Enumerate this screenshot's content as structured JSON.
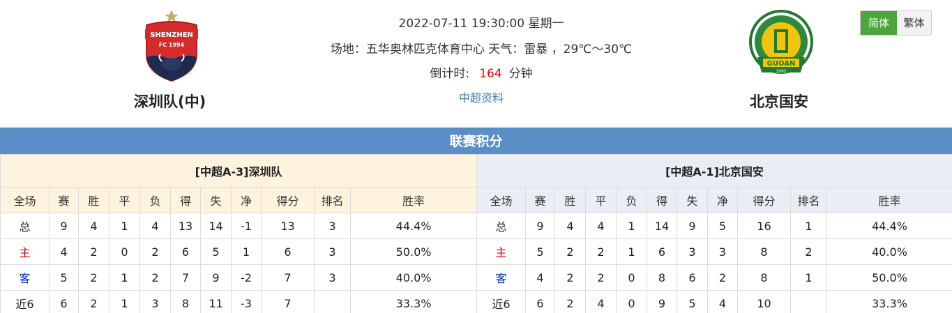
{
  "match": {
    "datetime": "2022-07-11 19:30:00 星期一",
    "venue": "场地：五华奥林匹克体育中心 天气：雷暴 ，29℃～30℃",
    "countdown_label": "倒计时:",
    "countdown_value": "164",
    "countdown_unit": "分钟",
    "league_link": "中超资料"
  },
  "home_team": {
    "name": "深圳队(中)",
    "logo_text": "SHENZHEN",
    "logo_sub": "FC 1994"
  },
  "away_team": {
    "name": "北京国安",
    "logo_text": "GUOAN",
    "logo_sub": "1992"
  },
  "lang": {
    "simplified": "简体",
    "traditional": "繁体"
  },
  "league_title": "联赛积分",
  "columns": [
    "全场",
    "赛",
    "胜",
    "平",
    "负",
    "得",
    "失",
    "净",
    "得分",
    "排名",
    "胜率"
  ],
  "home_table": {
    "title": "[中超A-3]深圳队",
    "rows": [
      {
        "label": "总",
        "cells": [
          "9",
          "4",
          "1",
          "4",
          "13",
          "14",
          "-1",
          "13",
          "3",
          "44.4%"
        ]
      },
      {
        "label": "主",
        "cells": [
          "4",
          "2",
          "0",
          "2",
          "6",
          "5",
          "1",
          "6",
          "3",
          "50.0%"
        ]
      },
      {
        "label": "客",
        "cells": [
          "5",
          "2",
          "1",
          "2",
          "7",
          "9",
          "-2",
          "7",
          "3",
          "40.0%"
        ]
      },
      {
        "label": "近6",
        "cells": [
          "6",
          "2",
          "1",
          "3",
          "8",
          "11",
          "-3",
          "7",
          "",
          "33.3%"
        ]
      }
    ]
  },
  "away_table": {
    "title": "[中超A-1]北京国安",
    "rows": [
      {
        "label": "总",
        "cells": [
          "9",
          "4",
          "4",
          "1",
          "14",
          "9",
          "5",
          "16",
          "1",
          "44.4%"
        ]
      },
      {
        "label": "主",
        "cells": [
          "5",
          "2",
          "2",
          "1",
          "6",
          "3",
          "3",
          "8",
          "2",
          "40.0%"
        ]
      },
      {
        "label": "客",
        "cells": [
          "4",
          "2",
          "2",
          "0",
          "8",
          "6",
          "2",
          "8",
          "1",
          "50.0%"
        ]
      },
      {
        "label": "近6",
        "cells": [
          "6",
          "2",
          "4",
          "0",
          "9",
          "5",
          "4",
          "10",
          "",
          "33.3%"
        ]
      }
    ]
  },
  "colors": {
    "header_bar": "#5b8ec6",
    "home_bg": "#fdf3de",
    "away_bg": "#e8eef4",
    "active_lang": "#4da63d",
    "home_label": "#d40000",
    "away_label": "#0030c8",
    "countdown": "#e00000",
    "link": "#3c7ac0"
  }
}
